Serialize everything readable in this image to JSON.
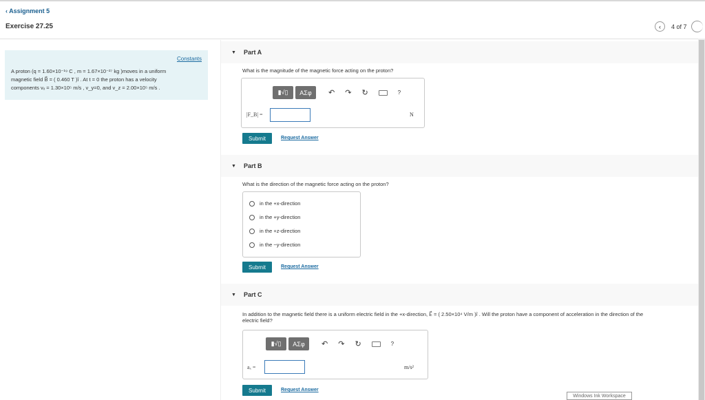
{
  "header": {
    "back_label": "Assignment 5",
    "title": "Exercise 27.25",
    "pager": "4 of 7"
  },
  "left_panel": {
    "constants_link": "Constants",
    "problem_lines": [
      "A proton (q = 1.60×10⁻¹⁹ C , m = 1.67×10⁻²⁷ kg )moves in a uniform",
      "magnetic field B⃗ = ( 0.460 T )î . At t = 0 the proton has a velocity",
      "components vₓ = 1.30×10⁵ m/s , v_y=0, and v_z = 2.00×10⁵ m/s ."
    ]
  },
  "parts": {
    "a": {
      "label": "Part A",
      "question": "What is the magnitude of the magnetic force acting on the proton?",
      "var_label": "|F_B| =",
      "input_value": "",
      "unit": "N",
      "submit": "Submit",
      "request": "Request Answer"
    },
    "b": {
      "label": "Part B",
      "question": "What is the direction of the magnetic force acting on the proton?",
      "options": [
        "in the +x-direction",
        "in the +y-direction",
        "in the +z-direction",
        "in the −y-direction"
      ],
      "submit": "Submit",
      "request": "Request Answer"
    },
    "c": {
      "label": "Part C",
      "question_line1": "In addition to the magnetic field there is a uniform electric field in the +x-direction, E⃗ = ( 2.50×10⁴ V/m )î . Will the proton have a component of acceleration in the direction of the",
      "question_line2": "electric field?",
      "var_label": "aₓ =",
      "input_value": "",
      "unit": "m/s²",
      "submit": "Submit",
      "request": "Request Answer"
    }
  },
  "toolbar": {
    "templates_label": "▮√▯",
    "greek_label": "ΑΣφ",
    "undo_icon": "↶",
    "redo_icon": "↷",
    "reset_icon": "↻",
    "help_label": "?"
  },
  "watermark": "Windows Ink Workspace"
}
